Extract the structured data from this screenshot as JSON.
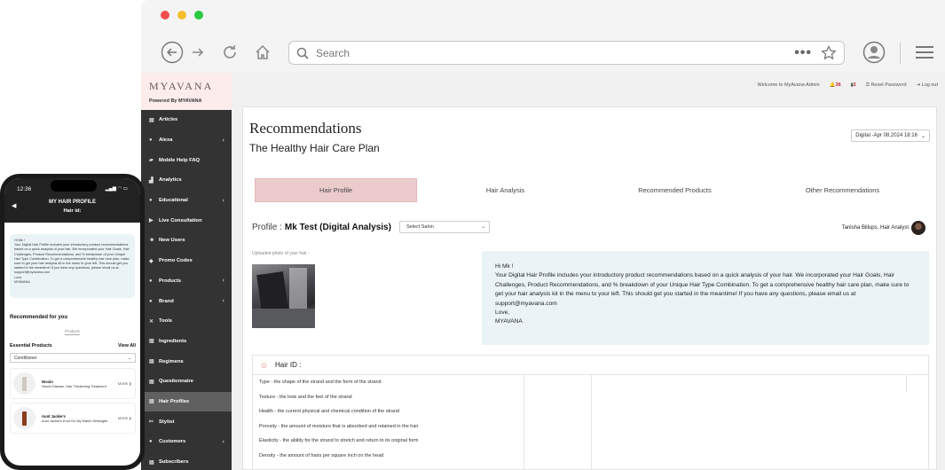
{
  "browser": {
    "search_placeholder": "Search",
    "traffic_lights": [
      "#f24e4e",
      "#f5bd2e",
      "#29c940"
    ]
  },
  "brand": {
    "logo": "MYAVANA",
    "powered": "Powered By MYAVANA"
  },
  "topbar": {
    "welcome": "Welcome to MyAvana Admin",
    "bell_count": "36",
    "doc_count": "2",
    "reset": "Reset Password",
    "logout": "Log out"
  },
  "sidebar": {
    "items": [
      {
        "label": "Articles",
        "icon": "document-icon",
        "caret": false
      },
      {
        "label": "Alexa",
        "icon": "circle-icon",
        "caret": true
      },
      {
        "label": "Mobile Help FAQ",
        "icon": "folder-icon",
        "caret": false
      },
      {
        "label": "Analytics",
        "icon": "chart-icon",
        "caret": false
      },
      {
        "label": "Educational",
        "icon": "circle-icon",
        "caret": true
      },
      {
        "label": "Live Consultation",
        "icon": "video-icon",
        "caret": false
      },
      {
        "label": "New Users",
        "icon": "user-icon",
        "caret": false
      },
      {
        "label": "Promo Codes",
        "icon": "tag-icon",
        "caret": false
      },
      {
        "label": "Products",
        "icon": "circle-icon",
        "caret": true
      },
      {
        "label": "Brand",
        "icon": "circle-icon",
        "caret": true
      },
      {
        "label": "Tools",
        "icon": "tools-icon",
        "caret": false
      },
      {
        "label": "Ingredients",
        "icon": "document-icon",
        "caret": false
      },
      {
        "label": "Regimens",
        "icon": "document-icon",
        "caret": false
      },
      {
        "label": "Questionnaire",
        "icon": "document-icon",
        "caret": false
      },
      {
        "label": "Hair Profiles",
        "icon": "document-icon",
        "caret": false,
        "active": true
      },
      {
        "label": "Stylist",
        "icon": "scissors-icon",
        "caret": false
      },
      {
        "label": "Customers",
        "icon": "circle-icon",
        "caret": true
      },
      {
        "label": "Subscribers",
        "icon": "document-icon",
        "caret": false
      }
    ]
  },
  "main": {
    "title": "Recommendations",
    "subtitle": "The Healthy Hair Care Plan",
    "date": "Digital -Apr 08,2024 18:16",
    "tabs": [
      "Hair Profile",
      "Hair Analysis",
      "Recommended Products",
      "Other Recommendations"
    ],
    "profile_label": "Profile :",
    "profile_name": "Mk Test (Digital Analysis)",
    "salon_placeholder": "Select Salon",
    "analyst": "Tanisha Billups, Hair Analyst",
    "upload_label": "Uploaded photo of your hair :",
    "message": {
      "greeting": "Hi Mk !",
      "body": "Your Digital Hair Profile includes your introductory product recommendations based on a quick analysis of your hair. We incorporated your Hair Goals, Hair Challenges, Product Recommendations, and % breakdown of your Unique Hair Type Combination. To get a comprehensive healthy hair care plan, make sure to get your hair analysis kit in the menu to your left. This should get you started in the meantime! If you have any questions, please email us at support@myavana.com",
      "closing": "Love,",
      "signature": "MYAVANA"
    },
    "hair_id": {
      "title": "Hair ID :",
      "rows": [
        "Type - the shape of the strand and the form of the strand",
        "Texture - the look and the feel of the strand",
        "Health - the current physical and chemical condition of the strand",
        "Porosity - the amount of moisture that is absorbed and retained in the hair",
        "Elasticity - the ability for the strand to stretch and return to its original form",
        "Density - the amount of hairs per square inch on the head"
      ]
    }
  },
  "phone": {
    "time": "12:36",
    "title": "MY HAIR PROFILE",
    "subtitle": "Hair id:",
    "message_greeting": "Hi Mk !",
    "message_body": "Your Digital Hair Profile includes your introductory product recommendations based on a quick analysis of your hair. We incorporated your Hair Goals, Hair Challenges, Product Recommendations, and % breakdown of your Unique Hair Type Combination. To get a comprehensive healthy hair care plan, make sure to get your hair analysis kit in the menu to your left. This should get you started in the meantime! If you have any questions, please email us at support@myavana.com",
    "message_closing": "Love,",
    "message_signature": "MYAVANA",
    "recommended": "Recommended for you",
    "products_tab": "Products",
    "essential": "Essential Products",
    "view_all": "View All",
    "select_value": "Conditioner",
    "cards": [
      {
        "brand": "Nioxin",
        "name": "Nioxin Diamax, Hair Thickening Treatment",
        "more": "MORE",
        "color": "#cfc9c2"
      },
      {
        "brand": "Aunt Jackie's",
        "name": "Aunt Jackie's Knot On My Watch Detangler",
        "more": "MORE",
        "color": "#8b3a1e"
      }
    ]
  }
}
